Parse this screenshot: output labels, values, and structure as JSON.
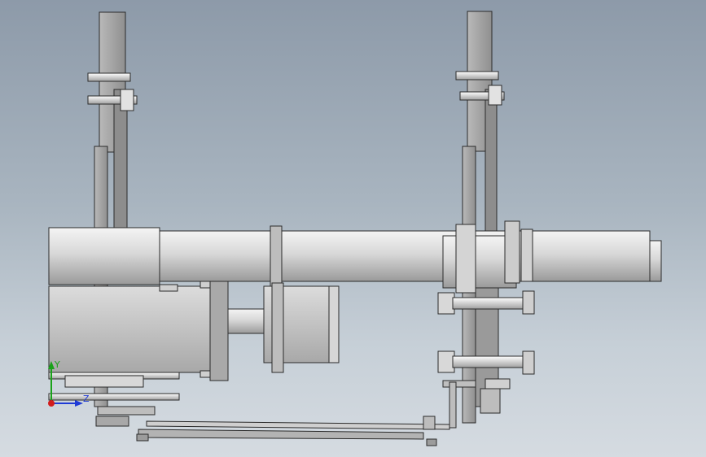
{
  "viewport": {
    "background_top": "#8d9aa9",
    "background_bottom": "#d5dbe1"
  },
  "model": {
    "part_fill": "#c9c9c9",
    "part_shadow": "#8e8e8e",
    "edge_color": "#2b2b2b"
  },
  "triad": {
    "x_label": "Z",
    "y_label": "Y",
    "x_color": "#1f3bd6",
    "y_color": "#1aa21a",
    "z_color": "#d21d1d",
    "icon": "coordinate-triad-icon"
  }
}
